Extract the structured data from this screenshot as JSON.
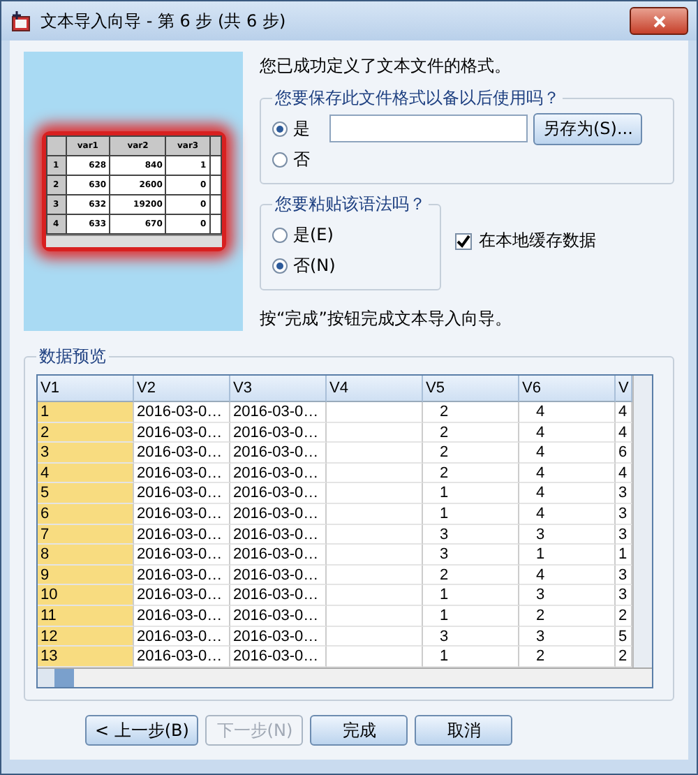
{
  "window": {
    "title": "文本导入向导 - 第 6 步 (共 6 步)"
  },
  "illustration": {
    "columns": [
      "var1",
      "var2",
      "var3"
    ],
    "rows": [
      {
        "index": "1",
        "cells": [
          "628",
          "840",
          "1"
        ]
      },
      {
        "index": "2",
        "cells": [
          "630",
          "2600",
          "0"
        ]
      },
      {
        "index": "3",
        "cells": [
          "632",
          "19200",
          "0"
        ]
      },
      {
        "index": "4",
        "cells": [
          "633",
          "670",
          "0"
        ]
      }
    ]
  },
  "intro": "您已成功定义了文本文件的格式。",
  "save_format": {
    "legend": "您要保存此文件格式以备以后使用吗？",
    "options": [
      {
        "label": "是",
        "selected": true
      },
      {
        "label": "否",
        "selected": false
      }
    ],
    "save_as_button": "另存为(S)..."
  },
  "paste_syntax": {
    "legend": "您要粘贴该语法吗？",
    "options": [
      {
        "label": "是(E)",
        "selected": false
      },
      {
        "label": "否(N)",
        "selected": true
      }
    ]
  },
  "cache_checkbox": {
    "label": "在本地缓存数据",
    "checked": true
  },
  "finish_hint": "按“完成”按钮完成文本导入向导。",
  "preview": {
    "legend": "数据预览",
    "columns": [
      "V1",
      "V2",
      "V3",
      "V4",
      "V5",
      "V6",
      "V"
    ],
    "rows": [
      {
        "cells": [
          "1",
          "2016-03-0…",
          "2016-03-0…",
          null,
          "2",
          "4",
          "4"
        ]
      },
      {
        "cells": [
          "2",
          "2016-03-0…",
          "2016-03-0…",
          null,
          "2",
          "4",
          "4"
        ]
      },
      {
        "cells": [
          "3",
          "2016-03-0…",
          "2016-03-0…",
          null,
          "2",
          "4",
          "6"
        ]
      },
      {
        "cells": [
          "4",
          "2016-03-0…",
          "2016-03-0…",
          null,
          "2",
          "4",
          "4"
        ]
      },
      {
        "cells": [
          "5",
          "2016-03-0…",
          "2016-03-0…",
          null,
          "1",
          "4",
          "3"
        ]
      },
      {
        "cells": [
          "6",
          "2016-03-0…",
          "2016-03-0…",
          null,
          "1",
          "4",
          "3"
        ]
      },
      {
        "cells": [
          "7",
          "2016-03-0…",
          "2016-03-0…",
          null,
          "3",
          "3",
          "3"
        ]
      },
      {
        "cells": [
          "8",
          "2016-03-0…",
          "2016-03-0…",
          null,
          "3",
          "1",
          "1"
        ]
      },
      {
        "cells": [
          "9",
          "2016-03-0…",
          "2016-03-0…",
          null,
          "2",
          "4",
          "3"
        ]
      },
      {
        "cells": [
          "10",
          "2016-03-0…",
          "2016-03-0…",
          null,
          "1",
          "3",
          "3"
        ]
      },
      {
        "cells": [
          "11",
          "2016-03-0…",
          "2016-03-0…",
          null,
          "1",
          "2",
          "2"
        ]
      },
      {
        "cells": [
          "12",
          "2016-03-0…",
          "2016-03-0…",
          null,
          "3",
          "3",
          "5"
        ]
      },
      {
        "cells": [
          "13",
          "2016-03-0…",
          "2016-03-0…",
          null,
          "1",
          "2",
          "2"
        ]
      }
    ]
  },
  "buttons": [
    {
      "label": "< 上一步(B)",
      "disabled": false
    },
    {
      "label": "下一步(N)",
      "disabled": true
    },
    {
      "label": "完成",
      "disabled": false
    },
    {
      "label": "取消",
      "disabled": false
    }
  ]
}
